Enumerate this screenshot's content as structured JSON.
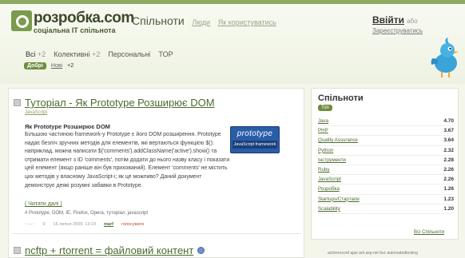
{
  "header": {
    "logo_text": "розробка.com",
    "logo_sub": "соціальна IT спільнота",
    "nav_active": "Спільноти",
    "nav_people": "Люди",
    "nav_users": "Як користуватись",
    "login": "Ввійти",
    "or": "або",
    "register": "Зареєструватись"
  },
  "tabs": [
    {
      "label": "Всі",
      "count": "+2"
    },
    {
      "label": "Колективні",
      "count": "+2"
    },
    {
      "label": "Персональні",
      "count": ""
    },
    {
      "label": "TOP",
      "count": ""
    }
  ],
  "subtabs": {
    "good": "Добрі",
    "new": "Нові",
    "new_count": "+2"
  },
  "post": {
    "title": "Туторіал - Як Prototype Розширює DOM",
    "category": "JavaScript",
    "heading": "Як Prototype Розширює DOM",
    "body": "Більшою частиною framework-у Prototype є його DOM розширення. Prototype надає безліч зручних методів для елементів, які вертаються функцією $(): наприклад, можна написати $('comments').addClassName('active').show() та отримати елемент з ID 'comments', потім додати до нього назву класу і показати цей елемент (якщо раніше він був прихований). Елемент 'comments' не містить цих методів у власному JavaScript-і; як це можливо? Даний документ демонструє деякі розумні забавки в Prototype.",
    "image_line1": "prototype",
    "image_line2": "JavaScript framework",
    "read_more": "( Читати далі )",
    "tags": "# Prototype, DOM, IE, Firefox, Opera, туторіал, javascript",
    "date": "15 липня 2009, 13:19",
    "author": "marf",
    "vote": "голосувати",
    "vote_count": "0"
  },
  "post2": {
    "title": "ncftp + rtorrent = файловий контент"
  },
  "sidebar": {
    "title": "Спільноти",
    "top_badge": "Топ",
    "items": [
      {
        "name": "Java",
        "value": "4.70"
      },
      {
        "name": "PHP",
        "value": "3.67"
      },
      {
        "name": "Quality Assurance",
        "value": "3.64"
      },
      {
        "name": "Python",
        "value": "2.32"
      },
      {
        "name": "Інструменти",
        "value": "2.28"
      },
      {
        "name": "Ruby",
        "value": "2.26"
      },
      {
        "name": "JavaScript",
        "value": "2.26"
      },
      {
        "name": "Розробка",
        "value": "1.26"
      },
      {
        "name": "Startups/Стартапи",
        "value": "1.23"
      },
      {
        "name": "Scalability",
        "value": "1.20"
      }
    ],
    "all_link": "Всі Спільноти"
  },
  "tag_cloud": "activerecord   ajax   ant   asp.net   bvc   automatedtesting"
}
